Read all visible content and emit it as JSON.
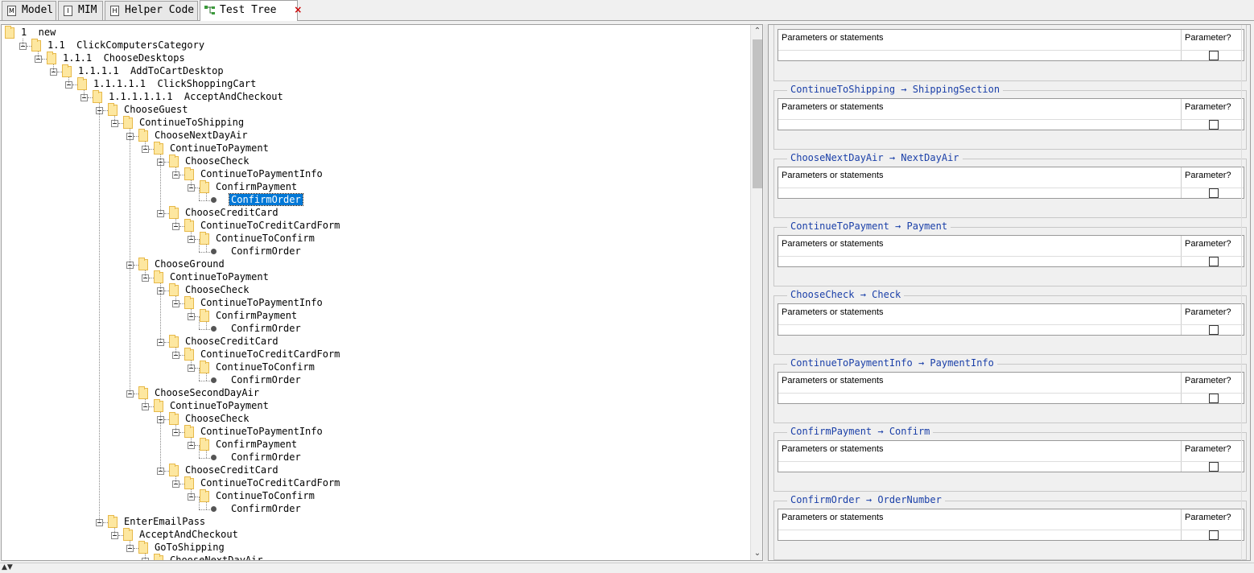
{
  "tabs": [
    {
      "label": "Model",
      "icon": "model-icon",
      "active": false
    },
    {
      "label": "MIM",
      "icon": "mim-icon",
      "active": false
    },
    {
      "label": "Helper Code",
      "icon": "helper-code-icon",
      "active": false
    },
    {
      "label": "Test Tree",
      "icon": "test-tree-icon",
      "active": true,
      "close": "×"
    }
  ],
  "tree": {
    "nodes": [
      {
        "level": 0,
        "label": "1  new",
        "type": "folder"
      },
      {
        "level": 1,
        "label": "1.1  ClickComputersCategory",
        "type": "folder"
      },
      {
        "level": 2,
        "label": "1.1.1  ChooseDesktops",
        "type": "folder"
      },
      {
        "level": 3,
        "label": "1.1.1.1  AddToCartDesktop",
        "type": "folder"
      },
      {
        "level": 4,
        "label": "1.1.1.1.1  ClickShoppingCart",
        "type": "folder"
      },
      {
        "level": 5,
        "label": "1.1.1.1.1.1  AcceptAndCheckout",
        "type": "folder"
      },
      {
        "level": 6,
        "label": "ChooseGuest",
        "type": "folder"
      },
      {
        "level": 7,
        "label": "ContinueToShipping",
        "type": "folder"
      },
      {
        "level": 8,
        "label": "ChooseNextDayAir",
        "type": "folder"
      },
      {
        "level": 9,
        "label": "ContinueToPayment",
        "type": "folder"
      },
      {
        "level": 10,
        "label": "ChooseCheck",
        "type": "folder"
      },
      {
        "level": 11,
        "label": "ContinueToPaymentInfo",
        "type": "folder"
      },
      {
        "level": 12,
        "label": "ConfirmPayment",
        "type": "folder"
      },
      {
        "level": 13,
        "label": "ConfirmOrder",
        "type": "leaf",
        "selected": true
      },
      {
        "level": 10,
        "label": "ChooseCreditCard",
        "type": "folder"
      },
      {
        "level": 11,
        "label": "ContinueToCreditCardForm",
        "type": "folder"
      },
      {
        "level": 12,
        "label": "ContinueToConfirm",
        "type": "folder"
      },
      {
        "level": 13,
        "label": "ConfirmOrder",
        "type": "leaf"
      },
      {
        "level": 8,
        "label": "ChooseGround",
        "type": "folder"
      },
      {
        "level": 9,
        "label": "ContinueToPayment",
        "type": "folder"
      },
      {
        "level": 10,
        "label": "ChooseCheck",
        "type": "folder"
      },
      {
        "level": 11,
        "label": "ContinueToPaymentInfo",
        "type": "folder"
      },
      {
        "level": 12,
        "label": "ConfirmPayment",
        "type": "folder"
      },
      {
        "level": 13,
        "label": "ConfirmOrder",
        "type": "leaf"
      },
      {
        "level": 10,
        "label": "ChooseCreditCard",
        "type": "folder"
      },
      {
        "level": 11,
        "label": "ContinueToCreditCardForm",
        "type": "folder"
      },
      {
        "level": 12,
        "label": "ContinueToConfirm",
        "type": "folder"
      },
      {
        "level": 13,
        "label": "ConfirmOrder",
        "type": "leaf"
      },
      {
        "level": 8,
        "label": "ChooseSecondDayAir",
        "type": "folder"
      },
      {
        "level": 9,
        "label": "ContinueToPayment",
        "type": "folder"
      },
      {
        "level": 10,
        "label": "ChooseCheck",
        "type": "folder"
      },
      {
        "level": 11,
        "label": "ContinueToPaymentInfo",
        "type": "folder"
      },
      {
        "level": 12,
        "label": "ConfirmPayment",
        "type": "folder"
      },
      {
        "level": 13,
        "label": "ConfirmOrder",
        "type": "leaf"
      },
      {
        "level": 10,
        "label": "ChooseCreditCard",
        "type": "folder"
      },
      {
        "level": 11,
        "label": "ContinueToCreditCardForm",
        "type": "folder"
      },
      {
        "level": 12,
        "label": "ContinueToConfirm",
        "type": "folder"
      },
      {
        "level": 13,
        "label": "ConfirmOrder",
        "type": "leaf"
      },
      {
        "level": 6,
        "label": "EnterEmailPass",
        "type": "folder"
      },
      {
        "level": 7,
        "label": "AcceptAndCheckout",
        "type": "folder"
      },
      {
        "level": 8,
        "label": "GoToShipping",
        "type": "folder"
      },
      {
        "level": 9,
        "label": "ChooseNextDayAir",
        "type": "folder"
      }
    ]
  },
  "scrollbar": {
    "up": "⌃",
    "down": "⌄"
  },
  "details": {
    "col_params": "Parameters or statements",
    "col_param_flag": "Parameter?",
    "groups": [
      {
        "title": ""
      },
      {
        "title": "ContinueToShipping → ShippingSection"
      },
      {
        "title": "ChooseNextDayAir → NextDayAir"
      },
      {
        "title": "ContinueToPayment → Payment"
      },
      {
        "title": "ChooseCheck → Check"
      },
      {
        "title": "ContinueToPaymentInfo → PaymentInfo"
      },
      {
        "title": "ConfirmPayment → Confirm"
      },
      {
        "title": "ConfirmOrder → OrderNumber"
      }
    ]
  },
  "bottom": {
    "updown": "▲▼"
  }
}
